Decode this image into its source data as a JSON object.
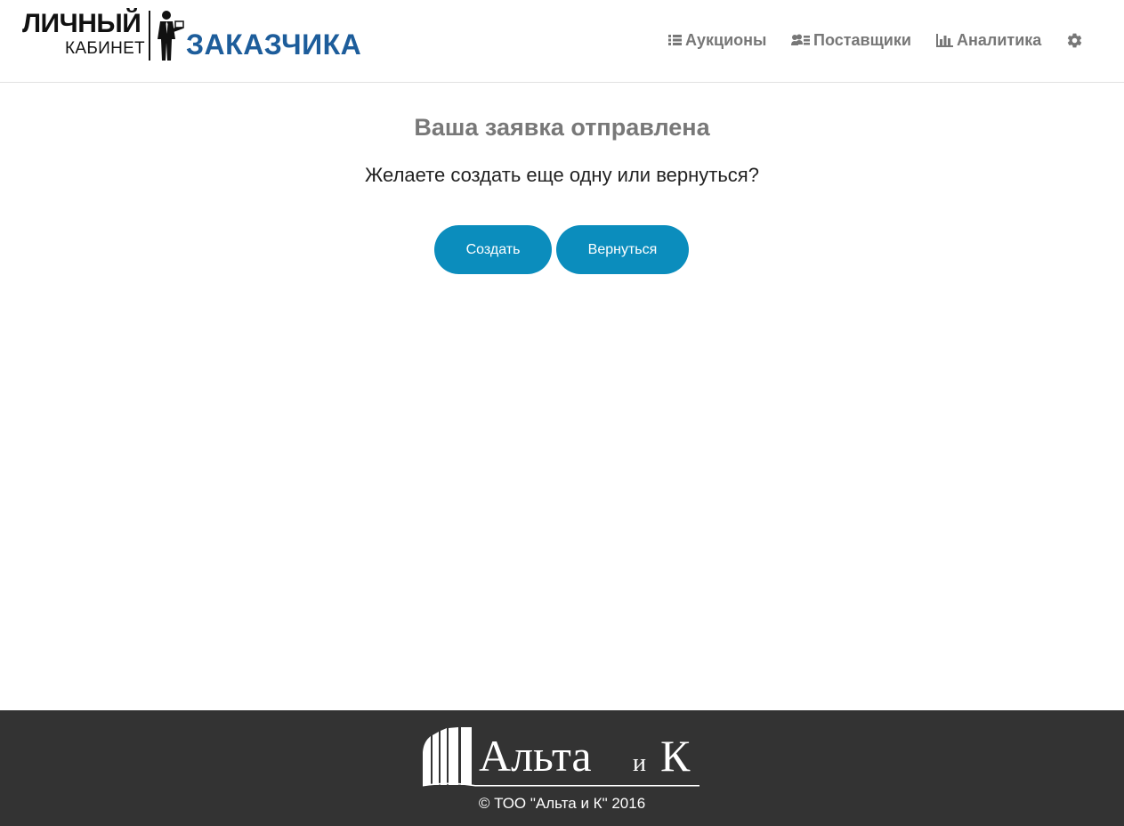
{
  "logo": {
    "line1": "ЛИЧНЫЙ",
    "line2": "КАБИНЕТ",
    "line3": "ЗАКАЗЧИКА",
    "brand_color": "#1d5d9b"
  },
  "nav": {
    "items": [
      {
        "label": "Аукционы",
        "icon": "list-icon"
      },
      {
        "label": "Поставщики",
        "icon": "users-card-icon"
      },
      {
        "label": "Аналитика",
        "icon": "bar-chart-icon"
      }
    ],
    "settings_icon": "gear-icon"
  },
  "main": {
    "title": "Ваша заявка отправлена",
    "subtitle": "Желаете создать еще одну или вернуться?",
    "create_label": "Создать",
    "back_label": "Вернуться",
    "button_color": "#0b8dbd"
  },
  "footer": {
    "brand_main": "Альта",
    "brand_and": "и",
    "brand_k": "К",
    "copyright": "© ТОО \"Альта и К\" 2016",
    "background": "#333333"
  }
}
